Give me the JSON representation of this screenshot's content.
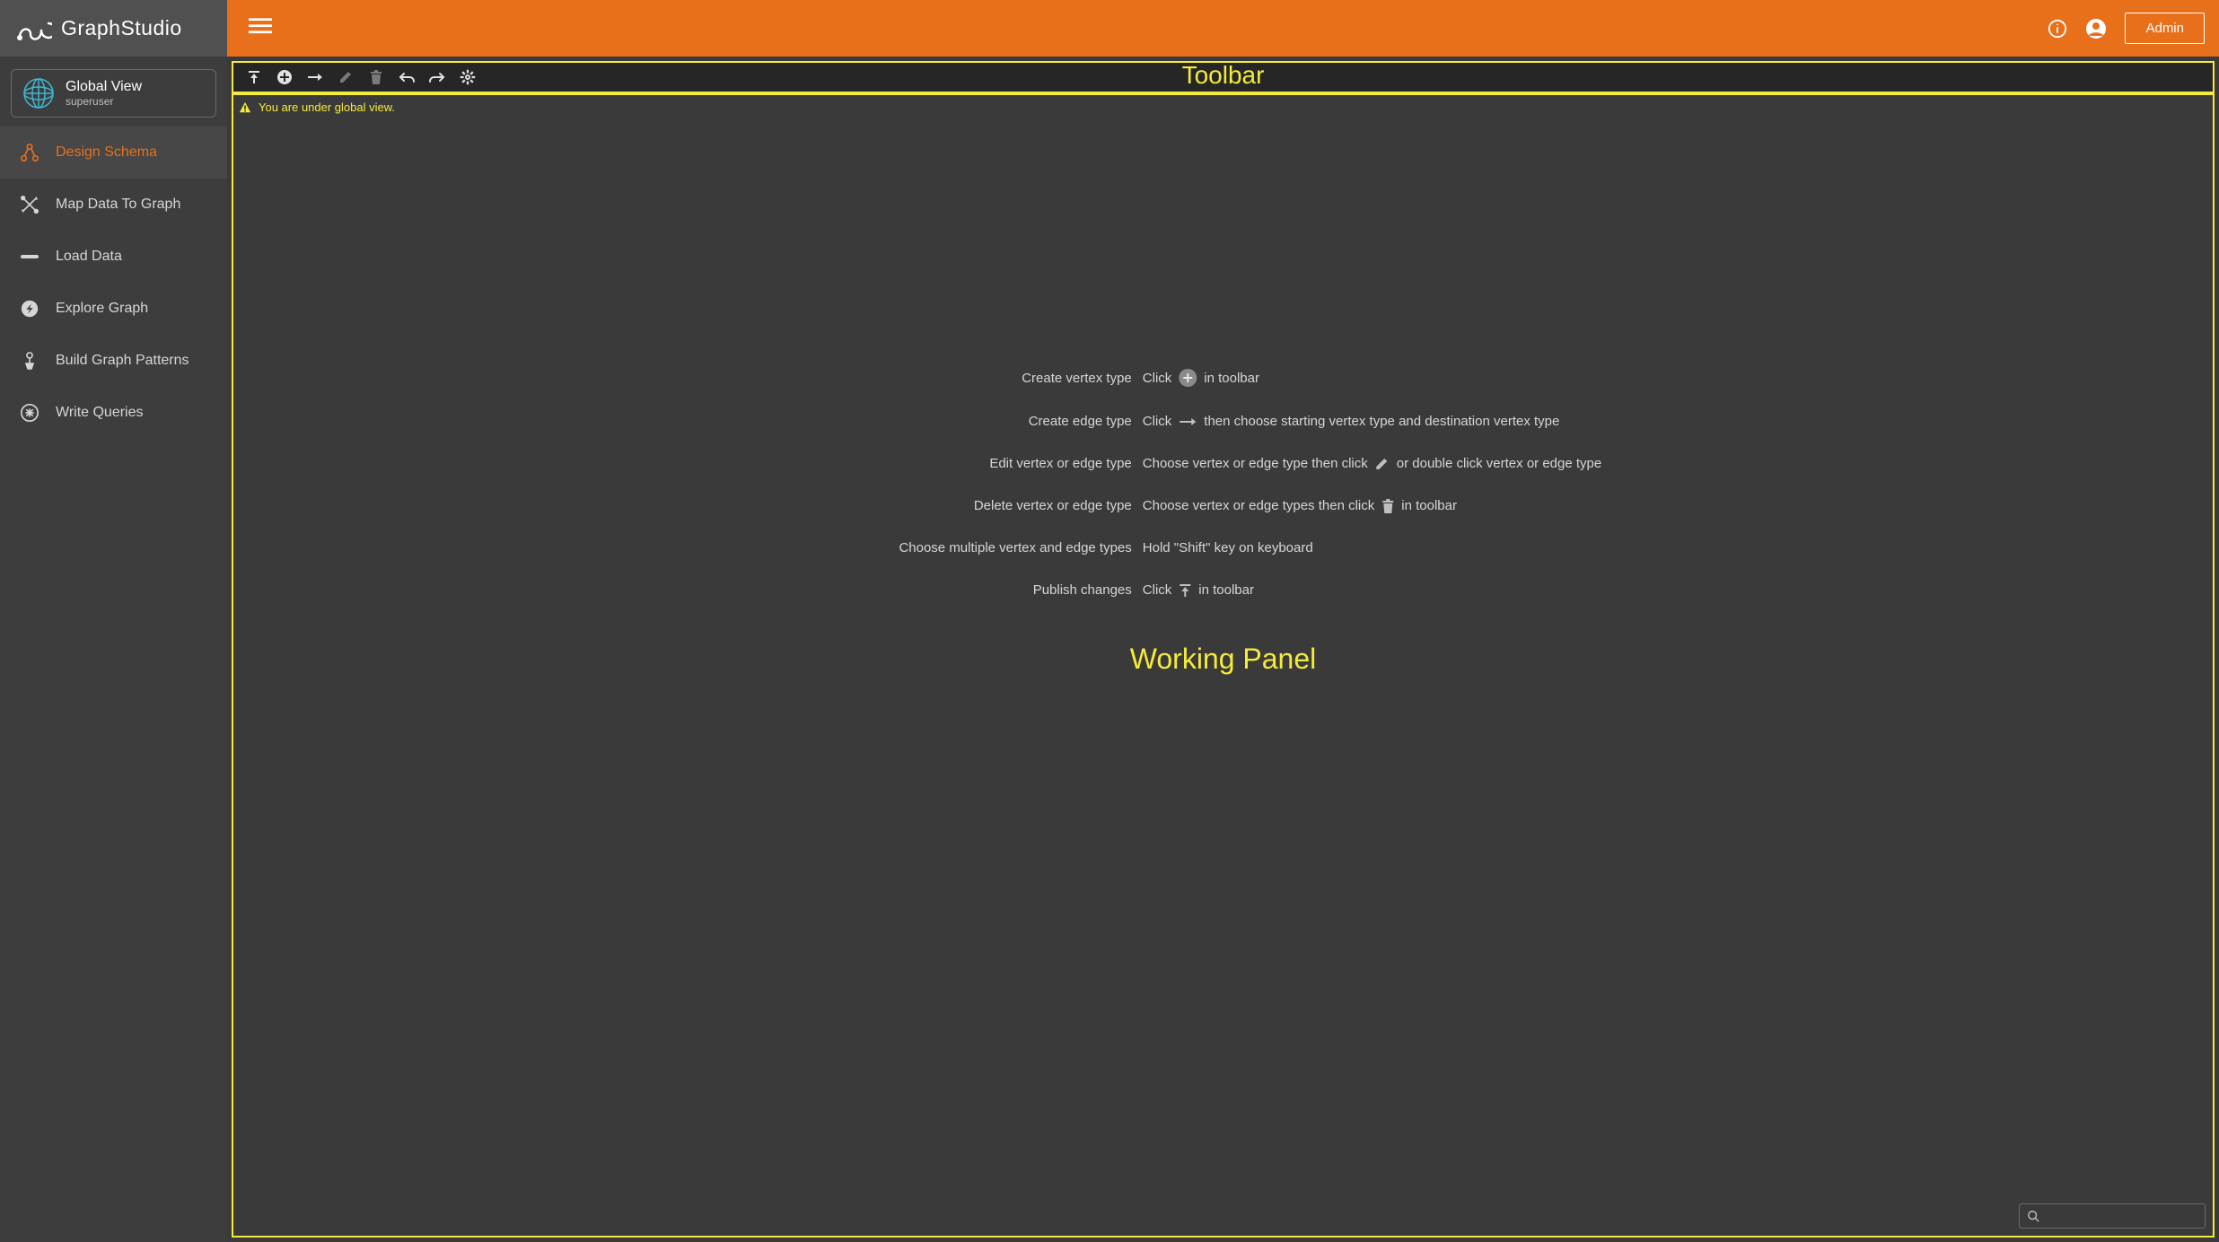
{
  "brand": {
    "line1": "Graph",
    "line2": "Studio"
  },
  "header": {
    "admin": "Admin"
  },
  "globalview": {
    "title": "Global View",
    "subtitle": "superuser"
  },
  "nav": {
    "items": [
      {
        "label": "Design Schema"
      },
      {
        "label": "Map Data To Graph"
      },
      {
        "label": "Load Data"
      },
      {
        "label": "Explore Graph"
      },
      {
        "label": "Build Graph Patterns"
      },
      {
        "label": "Write Queries"
      }
    ]
  },
  "labels": {
    "toolbar": "Toolbar",
    "workpanel": "Working Panel"
  },
  "warning": "You are under global view.",
  "help": {
    "rows": [
      {
        "label": "Create vertex type",
        "pre": "Click",
        "icon": "plus-circle",
        "post": "in toolbar"
      },
      {
        "label": "Create edge type",
        "pre": "Click",
        "icon": "arrow-right",
        "post": "then choose starting vertex type and destination vertex type"
      },
      {
        "label": "Edit vertex or edge type",
        "pre": "Choose vertex or edge type then click",
        "icon": "pencil",
        "post": "or double click vertex or edge type"
      },
      {
        "label": "Delete vertex or edge type",
        "pre": "Choose vertex or edge types then click",
        "icon": "trash",
        "post": "in toolbar"
      },
      {
        "label": "Choose multiple vertex and edge types",
        "pre": "Hold \"Shift\" key on keyboard",
        "icon": "",
        "post": ""
      },
      {
        "label": "Publish changes",
        "pre": "Click",
        "icon": "publish",
        "post": "in toolbar"
      }
    ]
  }
}
